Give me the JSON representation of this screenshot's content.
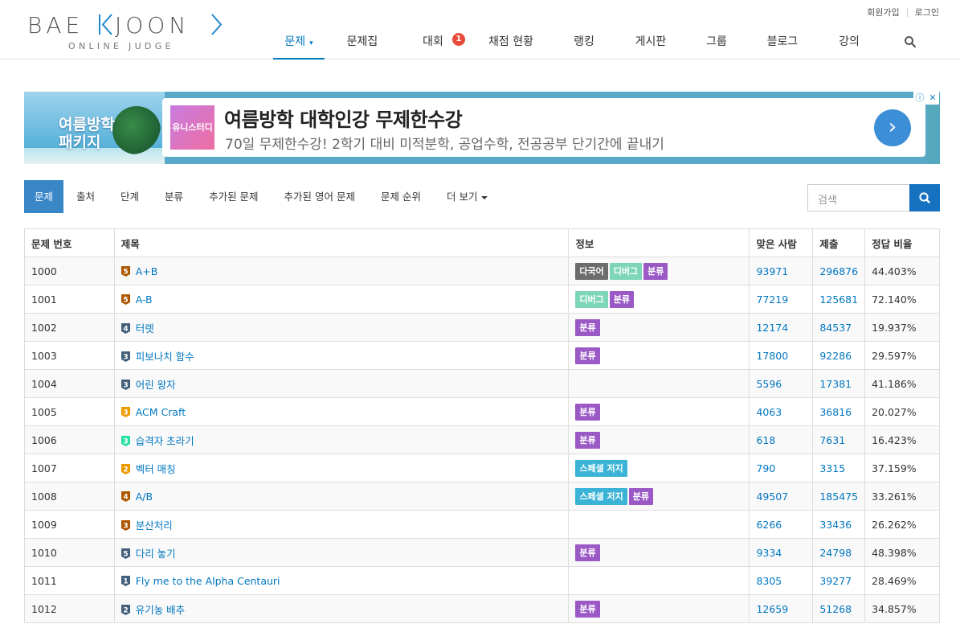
{
  "logo": {
    "main": "BAEKJOON",
    "sub": "ONLINE JUDGE"
  },
  "top_links": {
    "signup": "회원가입",
    "login": "로그인"
  },
  "nav": [
    {
      "label": "문제",
      "active": true,
      "caret": "▾"
    },
    {
      "label": "문제집"
    },
    {
      "label": "대회",
      "badge": "1"
    },
    {
      "label": "채점 현황"
    },
    {
      "label": "랭킹"
    },
    {
      "label": "게시판"
    },
    {
      "label": "그룹"
    },
    {
      "label": "블로그"
    },
    {
      "label": "강의"
    }
  ],
  "ad": {
    "left_title_1": "여름방학",
    "left_title_2": "패키지",
    "brand": "유니스터디",
    "headline": "여름방학 대학인강 무제한수강",
    "description": "70일 무제한수강! 2학기 대비 미적분학, 공업수학, 전공공부 단기간에 끝내기",
    "arrow": "›",
    "info_icon": "ⓘ",
    "close_icon": "✕"
  },
  "subnav": [
    {
      "label": "문제",
      "active": true
    },
    {
      "label": "출처"
    },
    {
      "label": "단계"
    },
    {
      "label": "분류"
    },
    {
      "label": "추가된 문제"
    },
    {
      "label": "추가된 영어 문제"
    },
    {
      "label": "문제 순위"
    },
    {
      "label": "더 보기",
      "dropdown": true
    }
  ],
  "search": {
    "placeholder": "검색"
  },
  "table": {
    "headers": [
      "문제 번호",
      "제목",
      "정보",
      "맞은 사람",
      "제출",
      "정답 비율"
    ],
    "rows": [
      {
        "id": "1000",
        "tier": "5",
        "tier_color": "#ad5600",
        "title": "A+B",
        "tags": [
          "다국어",
          "디버그",
          "분류"
        ],
        "solved": "93971",
        "submit": "296876",
        "ratio": "44.403%"
      },
      {
        "id": "1001",
        "tier": "5",
        "tier_color": "#ad5600",
        "title": "A-B",
        "tags": [
          "디버그",
          "분류"
        ],
        "solved": "77219",
        "submit": "125681",
        "ratio": "72.140%"
      },
      {
        "id": "1002",
        "tier": "4",
        "tier_color": "#435f7a",
        "title": "터렛",
        "tags": [
          "분류"
        ],
        "solved": "12174",
        "submit": "84537",
        "ratio": "19.937%"
      },
      {
        "id": "1003",
        "tier": "3",
        "tier_color": "#435f7a",
        "title": "피보나치 함수",
        "tags": [
          "분류"
        ],
        "solved": "17800",
        "submit": "92286",
        "ratio": "29.597%"
      },
      {
        "id": "1004",
        "tier": "3",
        "tier_color": "#435f7a",
        "title": "어린 왕자",
        "tags": [],
        "solved": "5596",
        "submit": "17381",
        "ratio": "41.186%"
      },
      {
        "id": "1005",
        "tier": "3",
        "tier_color": "#ec9a00",
        "title": "ACM Craft",
        "tags": [
          "분류"
        ],
        "solved": "4063",
        "submit": "36816",
        "ratio": "20.027%"
      },
      {
        "id": "1006",
        "tier": "3",
        "tier_color": "#27e2a4",
        "title": "습격자 초라기",
        "tags": [
          "분류"
        ],
        "solved": "618",
        "submit": "7631",
        "ratio": "16.423%"
      },
      {
        "id": "1007",
        "tier": "2",
        "tier_color": "#ec9a00",
        "title": "벡터 매칭",
        "tags": [
          "스페셜 저지"
        ],
        "solved": "790",
        "submit": "3315",
        "ratio": "37.159%"
      },
      {
        "id": "1008",
        "tier": "4",
        "tier_color": "#ad5600",
        "title": "A/B",
        "tags": [
          "스페셜 저지",
          "분류"
        ],
        "solved": "49507",
        "submit": "185475",
        "ratio": "33.261%"
      },
      {
        "id": "1009",
        "tier": "3",
        "tier_color": "#ad5600",
        "title": "분산처리",
        "tags": [],
        "solved": "6266",
        "submit": "33436",
        "ratio": "26.262%"
      },
      {
        "id": "1010",
        "tier": "5",
        "tier_color": "#435f7a",
        "title": "다리 놓기",
        "tags": [
          "분류"
        ],
        "solved": "9334",
        "submit": "24798",
        "ratio": "48.398%"
      },
      {
        "id": "1011",
        "tier": "1",
        "tier_color": "#435f7a",
        "title": "Fly me to the Alpha Centauri",
        "tags": [],
        "solved": "8305",
        "submit": "39277",
        "ratio": "28.469%"
      },
      {
        "id": "1012",
        "tier": "2",
        "tier_color": "#435f7a",
        "title": "유기농 배추",
        "tags": [
          "분류"
        ],
        "solved": "12659",
        "submit": "51268",
        "ratio": "34.857%"
      }
    ]
  }
}
